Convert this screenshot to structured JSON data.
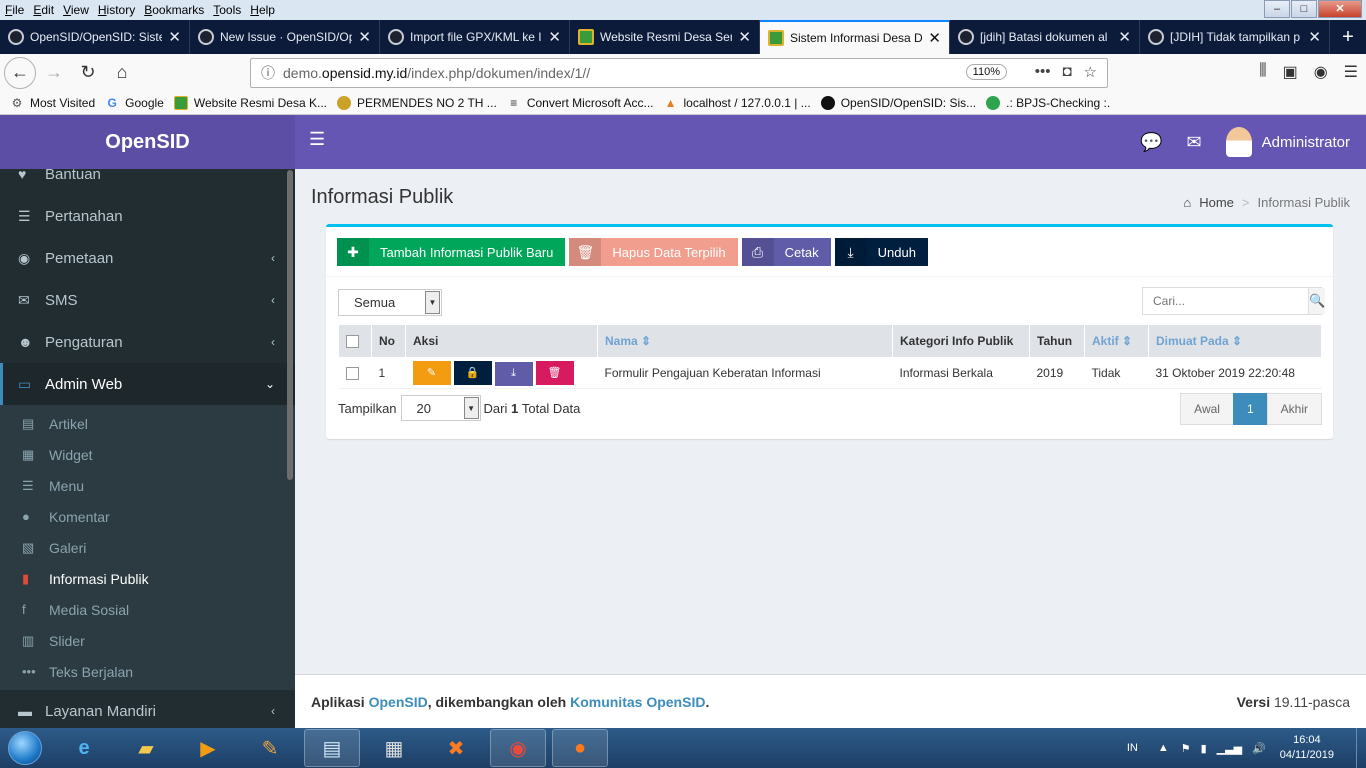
{
  "browser": {
    "menu": [
      "File",
      "Edit",
      "View",
      "History",
      "Bookmarks",
      "Tools",
      "Help"
    ],
    "tabs": [
      {
        "title": "OpenSID/OpenSID: Sistem",
        "active": false
      },
      {
        "title": "New Issue · OpenSID/Op",
        "active": false
      },
      {
        "title": "Import file GPX/KML ke I",
        "active": false
      },
      {
        "title": "Website Resmi Desa Sen",
        "active": false
      },
      {
        "title": "Sistem Informasi Desa De",
        "active": true
      },
      {
        "title": "[jdih] Batasi dokumen al",
        "active": false
      },
      {
        "title": "[JDIH] Tidak tampilkan p",
        "active": false
      }
    ],
    "url": {
      "prefix": "demo.",
      "host": "opensid.my.id",
      "path": "/index.php/dokumen/index/1//"
    },
    "zoom": "110%",
    "bookmarks": [
      "Most Visited",
      "Google",
      "Website Resmi Desa K...",
      "PERMENDES NO 2 TH ...",
      "Convert Microsoft Acc...",
      "localhost / 127.0.0.1 | ...",
      "OpenSID/OpenSID: Sis...",
      ".: BPJS-Checking :."
    ]
  },
  "header": {
    "brand": "OpenSID",
    "user": "Administrator"
  },
  "sidebar": {
    "items": [
      {
        "label": "Bantuan",
        "icon": "heart-icon",
        "glyph": "♥",
        "chevron": false
      },
      {
        "label": "Pertanahan",
        "icon": "land-icon",
        "glyph": "☰",
        "chevron": false
      },
      {
        "label": "Pemetaan",
        "icon": "globe-icon",
        "glyph": "◉",
        "chevron": true
      },
      {
        "label": "SMS",
        "icon": "envelope-icon",
        "glyph": "✉",
        "chevron": true
      },
      {
        "label": "Pengaturan",
        "icon": "users-icon",
        "glyph": "☻",
        "chevron": true
      }
    ],
    "active": {
      "label": "Admin Web",
      "icon": "desktop-icon",
      "glyph": "▭"
    },
    "sub": [
      {
        "label": "Artikel",
        "icon": "file-icon",
        "glyph": "▤"
      },
      {
        "label": "Widget",
        "icon": "widget-icon",
        "glyph": "▦"
      },
      {
        "label": "Menu",
        "icon": "menu-icon",
        "glyph": "☰"
      },
      {
        "label": "Komentar",
        "icon": "comment-icon",
        "glyph": "●"
      },
      {
        "label": "Galeri",
        "icon": "image-icon",
        "glyph": "▧"
      },
      {
        "label": "Informasi Publik",
        "icon": "pdf-icon",
        "glyph": "▮",
        "current": true
      },
      {
        "label": "Media Sosial",
        "icon": "facebook-icon",
        "glyph": "f"
      },
      {
        "label": "Slider",
        "icon": "film-icon",
        "glyph": "▥"
      },
      {
        "label": "Teks Berjalan",
        "icon": "ellipsis-icon",
        "glyph": "•••"
      }
    ],
    "bottom": {
      "label": "Layanan Mandiri",
      "icon": "inbox-icon",
      "glyph": "▬"
    }
  },
  "page": {
    "title": "Informasi Publik",
    "breadcrumb": {
      "home": "Home",
      "current": "Informasi Publik"
    }
  },
  "toolbar": {
    "add": "Tambah Informasi Publik Baru",
    "delete": "Hapus Data Terpilih",
    "print": "Cetak",
    "download": "Unduh"
  },
  "filter": {
    "value": "Semua"
  },
  "search": {
    "placeholder": "Cari..."
  },
  "table": {
    "headers": [
      "No",
      "Aksi",
      "Nama",
      "Kategori Info Publik",
      "Tahun",
      "Aktif",
      "Dimuat Pada"
    ],
    "rows": [
      {
        "no": "1",
        "nama": "Formulir Pengajuan Keberatan Informasi",
        "kategori": "Informasi Berkala",
        "tahun": "2019",
        "aktif": "Tidak",
        "dimuat": "31 Oktober 2019 22:20:48"
      }
    ]
  },
  "paging": {
    "show_label": "Tampilkan",
    "per_page": "20",
    "from_label": "Dari",
    "total": "1",
    "total_label": "Total Data",
    "first": "Awal",
    "current": "1",
    "last": "Akhir"
  },
  "footer": {
    "text1": "Aplikasi",
    "app": "OpenSID",
    "text2": ", dikembangkan oleh",
    "community": "Komunitas OpenSID",
    "version_label": "Versi",
    "version": "19.11-pasca"
  },
  "taskbar": {
    "lang": "IN",
    "time": "16:04",
    "date": "04/11/2019"
  }
}
